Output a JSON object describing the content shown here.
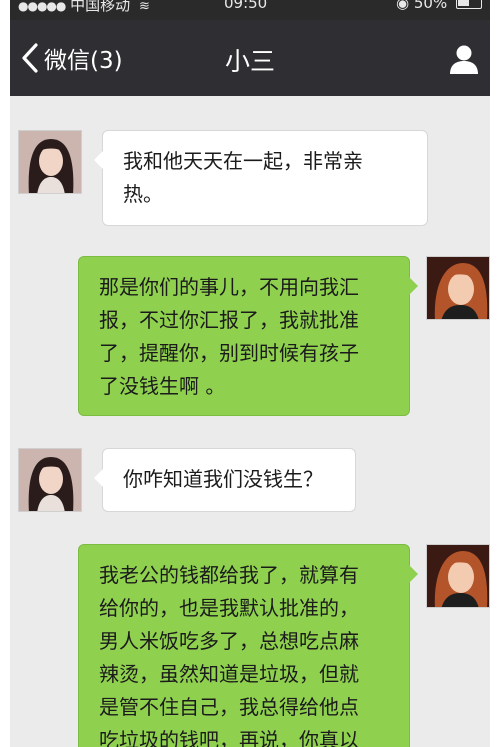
{
  "status_bar": {
    "signal_dots": "●●●●●",
    "carrier": "中国移动",
    "time": "09:50",
    "battery_text": "50%"
  },
  "nav": {
    "back_label": "微信(3)",
    "title": "小三"
  },
  "messages": [
    {
      "side": "left",
      "avatar": "girl-avatar",
      "lines": [
        "我和他天天在一起，非常亲",
        "热。"
      ]
    },
    {
      "side": "right",
      "avatar": "lady-avatar",
      "lines": [
        "那是你们的事儿，不用向我汇",
        "报，不过你汇报了，我就批准",
        "了，提醒你，别到时候有孩子",
        "了没钱生啊 。"
      ]
    },
    {
      "side": "left",
      "avatar": "girl-avatar",
      "lines": [
        "你咋知道我们没钱生？"
      ]
    },
    {
      "side": "right",
      "avatar": "lady-avatar",
      "lines": [
        "我老公的钱都给我了，就算有",
        "给你的，也是我默认批准的，",
        "男人米饭吃多了，总想吃点麻",
        "辣烫，虽然知道是垃圾，但就",
        "是管不住自己，我总得给他点",
        "吃垃圾的钱吧，再说，你真以"
      ]
    }
  ],
  "colors": {
    "nav_bg": "#2f2f33",
    "chat_bg": "#ebebeb",
    "sent_bubble": "#8fd14f",
    "received_bubble": "#ffffff"
  }
}
